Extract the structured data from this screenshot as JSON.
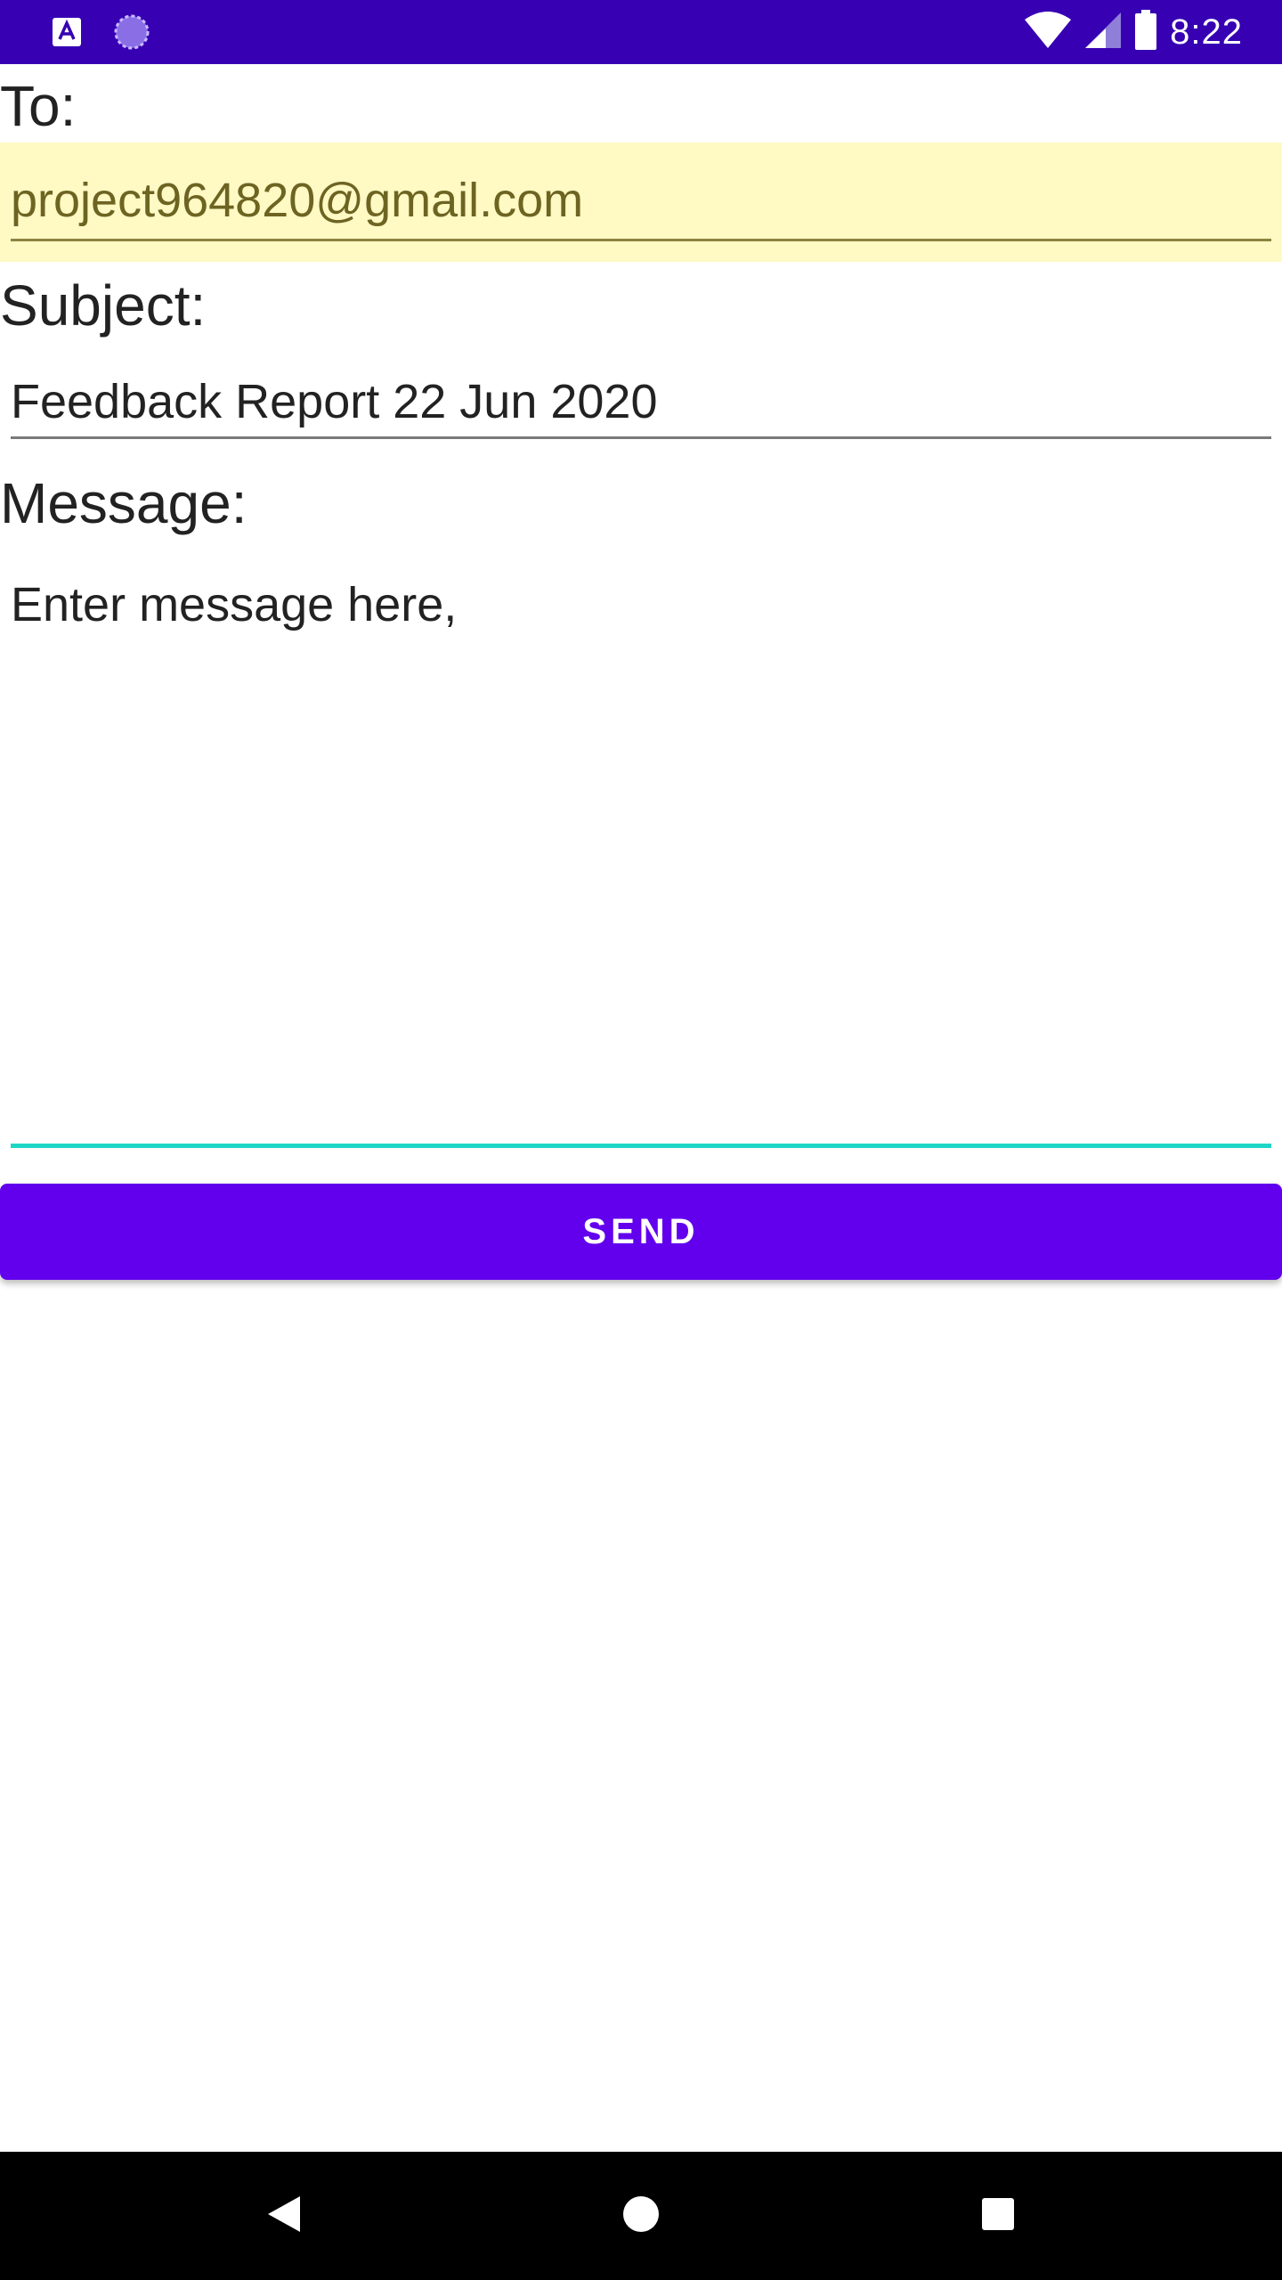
{
  "status_bar": {
    "time": "8:22",
    "left_icons": [
      "app-a-icon",
      "sync-icon"
    ],
    "right_icons": [
      "wifi-icon",
      "cell-signal-icon",
      "battery-icon"
    ],
    "background": "#3700b3"
  },
  "form": {
    "to_label": "To:",
    "to_value": "project964820@gmail.com",
    "subject_label": "Subject:",
    "subject_value": "Feedback Report 22 Jun 2020",
    "message_label": "Message:",
    "message_placeholder": "Enter message here,",
    "to_field_highlight": "#fff9c4",
    "message_focus_color": "#1fd6c4"
  },
  "send_button": {
    "label": "SEND",
    "color": "#6200ee"
  },
  "nav_bar": {
    "icons": [
      "back-icon",
      "home-icon",
      "recents-icon"
    ]
  }
}
